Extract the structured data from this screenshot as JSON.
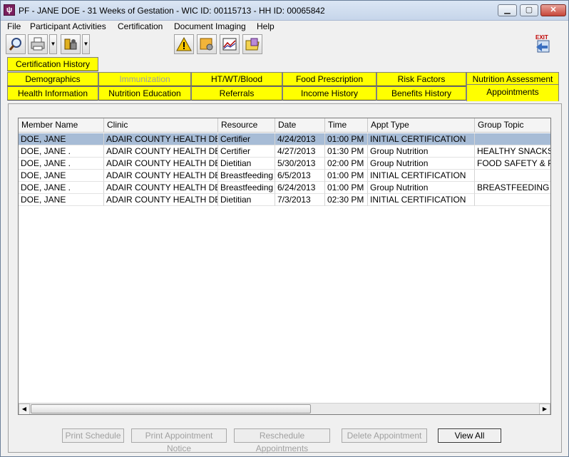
{
  "window": {
    "title": "PF - JANE DOE - 31 Weeks of Gestation - WIC ID: 00115713 - HH ID: 00065842"
  },
  "menu": {
    "items": [
      "File",
      "Participant Activities",
      "Certification",
      "Document Imaging",
      "Help"
    ]
  },
  "toolbar": {
    "exit_label": "EXIT"
  },
  "tabs": {
    "row0": [
      "Certification History"
    ],
    "row1": [
      "Demographics",
      "Immunization",
      "HT/WT/Blood",
      "Food Prescription",
      "Risk Factors",
      "Nutrition Assessment"
    ],
    "row2": [
      "Health Information",
      "Nutrition Education",
      "Referrals",
      "Income History",
      "Benefits History",
      "Appointments"
    ],
    "active": "Appointments",
    "disabled": [
      "Immunization"
    ],
    "accent": "#ffff00"
  },
  "grid": {
    "columns": [
      "Member Name",
      "Clinic",
      "Resource",
      "Date",
      "Time",
      "Appt Type",
      "Group Topic"
    ],
    "rows": [
      [
        "DOE, JANE",
        "ADAIR COUNTY HEALTH DE",
        "Certifier",
        "4/24/2013",
        "01:00 PM",
        "INITIAL CERTIFICATION",
        ""
      ],
      [
        "DOE, JANE  .",
        "ADAIR COUNTY HEALTH DE",
        "Certifier",
        "4/27/2013",
        "01:30 PM",
        "Group Nutrition",
        "HEALTHY SNACKS"
      ],
      [
        "DOE, JANE  .",
        "ADAIR COUNTY HEALTH DE",
        "Dietitian",
        "5/30/2013",
        "02:00 PM",
        "Group Nutrition",
        "FOOD SAFETY & PR"
      ],
      [
        "DOE, JANE",
        "ADAIR COUNTY HEALTH DE",
        "Breastfeeding",
        "6/5/2013",
        "01:00 PM",
        "INITIAL CERTIFICATION",
        ""
      ],
      [
        "DOE, JANE  .",
        "ADAIR COUNTY HEALTH DE",
        "Breastfeeding",
        "6/24/2013",
        "01:00 PM",
        "Group Nutrition",
        "BREASTFEEDING C"
      ],
      [
        "DOE, JANE",
        "ADAIR COUNTY HEALTH DE",
        "Dietitian",
        "7/3/2013",
        "02:30 PM",
        "INITIAL CERTIFICATION",
        ""
      ]
    ],
    "selected_row": 0,
    "selection_color": "#a7bcd6"
  },
  "buttons": {
    "print_schedule": "Print Schedule",
    "print_notice": "Print Appointment Notice",
    "reschedule": "Reschedule Appointments",
    "delete": "Delete Appointment",
    "view_all": "View All"
  }
}
